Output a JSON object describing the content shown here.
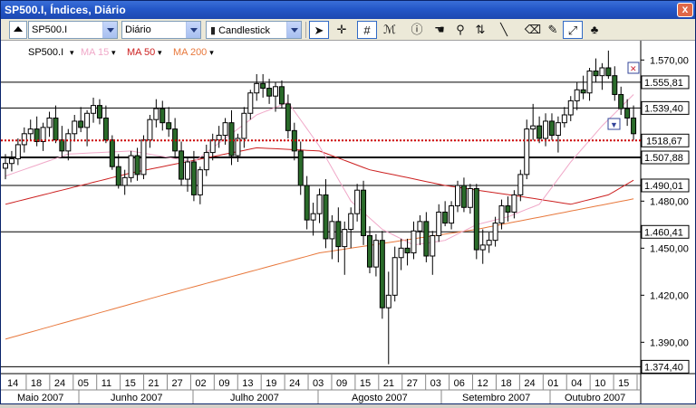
{
  "window": {
    "title": "SP500.I, Índices, Diário",
    "close_glyph": "x"
  },
  "toolbar": {
    "symbol": "SP500.I",
    "period": "Diário",
    "chart_type": "Candlestick",
    "tools": [
      "arrow-pointer-icon",
      "crosshair-icon",
      "grid-icon",
      "indicator-icon",
      "info-icon",
      "hand-icon",
      "zoom-icon",
      "scale-icon",
      "line-icon",
      "eraser-icon",
      "paint-icon",
      "chart-arrows-icon",
      "clover-icon"
    ]
  },
  "legend": {
    "symbol": "SP500.I",
    "items": [
      {
        "label": "MA 15",
        "color": "#f0a8c8"
      },
      {
        "label": "MA 50",
        "color": "#cc2020"
      },
      {
        "label": "MA 200",
        "color": "#e8783c"
      }
    ]
  },
  "chart_data": {
    "type": "candlestick",
    "ylim": [
      1370,
      1580
    ],
    "yticks": [
      1390,
      1420,
      1450,
      1480,
      1570
    ],
    "ytick_labels": [
      "1.390,00",
      "1.420,00",
      "1.450,00",
      "1.480,00",
      "1.570,00"
    ],
    "hlines": [
      {
        "value": 1555.81,
        "label": "1.555,81"
      },
      {
        "value": 1539.4,
        "label": "1.539,40"
      },
      {
        "value": 1507.88,
        "label": "1.507,88",
        "bold": true
      },
      {
        "value": 1490.01,
        "label": "1.490,01"
      },
      {
        "value": 1460.41,
        "label": "1.460,41"
      },
      {
        "value": 1374.4,
        "label": "1.374,40"
      }
    ],
    "current": {
      "value": 1518.67,
      "label": "1518,67",
      "color": "#cc0000"
    },
    "x_day_labels": [
      "14",
      "18",
      "24",
      "05",
      "11",
      "15",
      "21",
      "27",
      "02",
      "09",
      "13",
      "19",
      "24",
      "03",
      "09",
      "15",
      "21",
      "27",
      "03",
      "06",
      "12",
      "18",
      "24",
      "01",
      "04",
      "10",
      "15"
    ],
    "months": [
      "Maio 2007",
      "Junho 2007",
      "Julho 2007",
      "Agosto 2007",
      "Setembro 2007",
      "Outubro 2007"
    ],
    "candles": [
      [
        1501,
        1510,
        1494,
        1504
      ],
      [
        1504,
        1512,
        1499,
        1507
      ],
      [
        1507,
        1520,
        1503,
        1516
      ],
      [
        1516,
        1527,
        1511,
        1523
      ],
      [
        1523,
        1532,
        1519,
        1526
      ],
      [
        1526,
        1534,
        1515,
        1518
      ],
      [
        1518,
        1530,
        1512,
        1527
      ],
      [
        1527,
        1537,
        1521,
        1533
      ],
      [
        1533,
        1541,
        1517,
        1519
      ],
      [
        1519,
        1528,
        1508,
        1512
      ],
      [
        1512,
        1526,
        1506,
        1523
      ],
      [
        1523,
        1535,
        1518,
        1531
      ],
      [
        1531,
        1540,
        1524,
        1527
      ],
      [
        1527,
        1538,
        1515,
        1536
      ],
      [
        1536,
        1546,
        1530,
        1541
      ],
      [
        1541,
        1545,
        1529,
        1533
      ],
      [
        1533,
        1541,
        1517,
        1519
      ],
      [
        1519,
        1522,
        1500,
        1502
      ],
      [
        1502,
        1510,
        1488,
        1490
      ],
      [
        1490,
        1500,
        1484,
        1495
      ],
      [
        1495,
        1512,
        1492,
        1509
      ],
      [
        1509,
        1514,
        1493,
        1497
      ],
      [
        1497,
        1522,
        1494,
        1519
      ],
      [
        1519,
        1535,
        1514,
        1532
      ],
      [
        1532,
        1545,
        1527,
        1539
      ],
      [
        1539,
        1544,
        1525,
        1530
      ],
      [
        1530,
        1540,
        1521,
        1526
      ],
      [
        1526,
        1533,
        1508,
        1512
      ],
      [
        1512,
        1518,
        1490,
        1494
      ],
      [
        1494,
        1508,
        1486,
        1505
      ],
      [
        1505,
        1512,
        1480,
        1484
      ],
      [
        1484,
        1502,
        1478,
        1500
      ],
      [
        1500,
        1516,
        1496,
        1511
      ],
      [
        1511,
        1523,
        1506,
        1519
      ],
      [
        1519,
        1528,
        1514,
        1522
      ],
      [
        1522,
        1533,
        1516,
        1530
      ],
      [
        1530,
        1538,
        1503,
        1509
      ],
      [
        1509,
        1523,
        1505,
        1520
      ],
      [
        1520,
        1540,
        1514,
        1536
      ],
      [
        1536,
        1551,
        1532,
        1549
      ],
      [
        1549,
        1561,
        1544,
        1555
      ],
      [
        1555,
        1561,
        1546,
        1552
      ],
      [
        1552,
        1558,
        1542,
        1547
      ],
      [
        1547,
        1556,
        1537,
        1553
      ],
      [
        1553,
        1557,
        1539,
        1542
      ],
      [
        1542,
        1548,
        1520,
        1525
      ],
      [
        1525,
        1530,
        1506,
        1512
      ],
      [
        1512,
        1518,
        1484,
        1490
      ],
      [
        1490,
        1496,
        1462,
        1468
      ],
      [
        1468,
        1479,
        1458,
        1472
      ],
      [
        1472,
        1488,
        1466,
        1484
      ],
      [
        1484,
        1494,
        1450,
        1456
      ],
      [
        1456,
        1471,
        1443,
        1467
      ],
      [
        1467,
        1476,
        1441,
        1451
      ],
      [
        1451,
        1467,
        1433,
        1462
      ],
      [
        1462,
        1476,
        1450,
        1472
      ],
      [
        1472,
        1491,
        1467,
        1487
      ],
      [
        1487,
        1493,
        1452,
        1458
      ],
      [
        1458,
        1464,
        1434,
        1438
      ],
      [
        1438,
        1459,
        1432,
        1455
      ],
      [
        1455,
        1461,
        1405,
        1412
      ],
      [
        1412,
        1435,
        1376,
        1420
      ],
      [
        1420,
        1451,
        1416,
        1444
      ],
      [
        1444,
        1456,
        1436,
        1450
      ],
      [
        1450,
        1456,
        1439,
        1447
      ],
      [
        1447,
        1467,
        1443,
        1461
      ],
      [
        1461,
        1471,
        1452,
        1467
      ],
      [
        1467,
        1473,
        1441,
        1445
      ],
      [
        1445,
        1461,
        1433,
        1458
      ],
      [
        1458,
        1478,
        1454,
        1473
      ],
      [
        1473,
        1480,
        1464,
        1466
      ],
      [
        1466,
        1480,
        1462,
        1477
      ],
      [
        1477,
        1493,
        1473,
        1490
      ],
      [
        1490,
        1495,
        1473,
        1476
      ],
      [
        1476,
        1491,
        1472,
        1488
      ],
      [
        1488,
        1491,
        1443,
        1449
      ],
      [
        1449,
        1462,
        1440,
        1452
      ],
      [
        1452,
        1460,
        1447,
        1455
      ],
      [
        1455,
        1470,
        1451,
        1466
      ],
      [
        1466,
        1481,
        1462,
        1477
      ],
      [
        1477,
        1483,
        1467,
        1473
      ],
      [
        1473,
        1487,
        1469,
        1484
      ],
      [
        1484,
        1500,
        1480,
        1497
      ],
      [
        1497,
        1532,
        1494,
        1526
      ],
      [
        1526,
        1542,
        1519,
        1528
      ],
      [
        1528,
        1534,
        1517,
        1520
      ],
      [
        1520,
        1536,
        1515,
        1531
      ],
      [
        1531,
        1536,
        1519,
        1522
      ],
      [
        1522,
        1534,
        1511,
        1530
      ],
      [
        1530,
        1540,
        1527,
        1535
      ],
      [
        1535,
        1547,
        1531,
        1544
      ],
      [
        1544,
        1556,
        1538,
        1551
      ],
      [
        1551,
        1560,
        1545,
        1549
      ],
      [
        1549,
        1565,
        1544,
        1563
      ],
      [
        1563,
        1571,
        1556,
        1560
      ],
      [
        1560,
        1568,
        1551,
        1565
      ],
      [
        1565,
        1576,
        1558,
        1560
      ],
      [
        1560,
        1566,
        1544,
        1548
      ],
      [
        1548,
        1553,
        1535,
        1539
      ],
      [
        1539,
        1545,
        1528,
        1533
      ],
      [
        1533,
        1541,
        1519,
        1523
      ]
    ],
    "ma15_anchors": [
      [
        0,
        1496
      ],
      [
        10,
        1510
      ],
      [
        20,
        1512
      ],
      [
        30,
        1505
      ],
      [
        40,
        1535
      ],
      [
        45,
        1543
      ],
      [
        50,
        1515
      ],
      [
        55,
        1480
      ],
      [
        60,
        1462
      ],
      [
        65,
        1452
      ],
      [
        70,
        1455
      ],
      [
        75,
        1465
      ],
      [
        80,
        1470
      ],
      [
        85,
        1478
      ],
      [
        90,
        1505
      ],
      [
        95,
        1528
      ],
      [
        100,
        1548
      ],
      [
        102,
        1543
      ]
    ],
    "ma50_anchors": [
      [
        0,
        1478
      ],
      [
        20,
        1498
      ],
      [
        40,
        1514
      ],
      [
        50,
        1512
      ],
      [
        58,
        1500
      ],
      [
        70,
        1490
      ],
      [
        82,
        1483
      ],
      [
        90,
        1478
      ],
      [
        96,
        1484
      ],
      [
        102,
        1498
      ]
    ],
    "ma200_anchors": [
      [
        0,
        1392
      ],
      [
        25,
        1420
      ],
      [
        50,
        1447
      ],
      [
        75,
        1462
      ],
      [
        102,
        1483
      ]
    ]
  }
}
